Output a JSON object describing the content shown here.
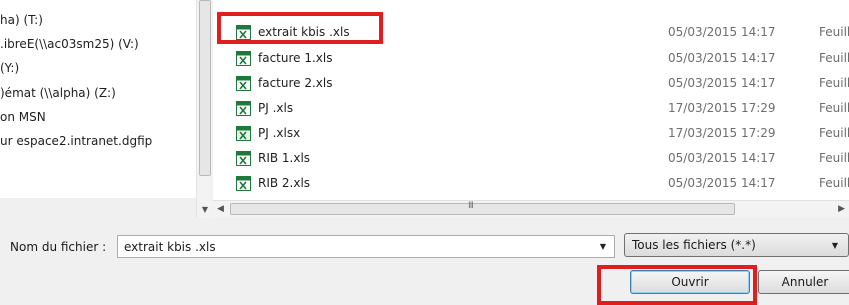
{
  "nav": {
    "items": [
      {
        "label": "ha) (T:)"
      },
      {
        "label": ".ibreE(\\\\ac03sm25) (V:)"
      },
      {
        "label": "(Y:)"
      },
      {
        "label": ")émat (\\\\alpha) (Z:)"
      },
      {
        "label": "on MSN"
      },
      {
        "label": "ur espace2.intranet.dgfip"
      }
    ]
  },
  "files": [
    {
      "name": "extrait kbis .xls",
      "date": "05/03/2015 14:17",
      "type": "Feuill",
      "icon": "excel-icon"
    },
    {
      "name": "facture 1.xls",
      "date": "05/03/2015 14:17",
      "type": "Feuill",
      "icon": "excel-icon"
    },
    {
      "name": "facture 2.xls",
      "date": "05/03/2015 14:17",
      "type": "Feuill",
      "icon": "excel-icon"
    },
    {
      "name": "PJ .xls",
      "date": "17/03/2015 17:29",
      "type": "Feuill",
      "icon": "excel-icon"
    },
    {
      "name": "PJ .xlsx",
      "date": "17/03/2015 17:29",
      "type": "Feuill",
      "icon": "excel-icon"
    },
    {
      "name": "RIB 1.xls",
      "date": "05/03/2015 14:17",
      "type": "Feuill",
      "icon": "excel-icon"
    },
    {
      "name": "RIB 2.xls",
      "date": "05/03/2015 14:17",
      "type": "Feuill",
      "icon": "excel-icon"
    }
  ],
  "hscroll": {
    "grip": "III"
  },
  "bottom": {
    "filename_label": "Nom du fichier :",
    "filename_value": "extrait kbis .xls",
    "filetype_value": "Tous les fichiers (*.*)",
    "open_label": "Ouvrir",
    "cancel_label": "Annuler"
  },
  "colors": {
    "highlight": "#e01e1e",
    "excel_green": "#1d7a3a"
  }
}
